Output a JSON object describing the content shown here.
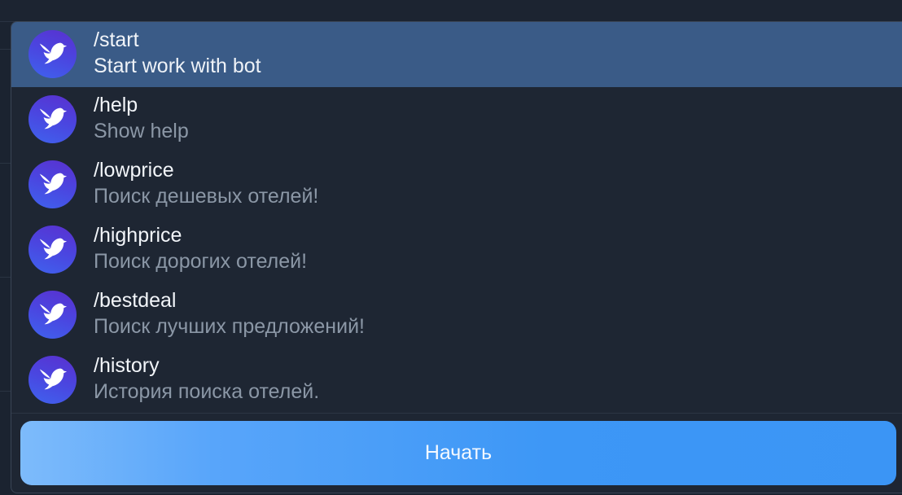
{
  "commands": [
    {
      "name": "/start",
      "description": "Start work with bot",
      "selected": true,
      "avatar_icon": "bird-icon"
    },
    {
      "name": "/help",
      "description": "Show help",
      "selected": false,
      "avatar_icon": "bird-icon"
    },
    {
      "name": "/lowprice",
      "description": "Поиск дешевых отелей!",
      "selected": false,
      "avatar_icon": "bird-icon"
    },
    {
      "name": "/highprice",
      "description": "Поиск дорогих отелей!",
      "selected": false,
      "avatar_icon": "bird-icon"
    },
    {
      "name": "/bestdeal",
      "description": "Поиск лучших предложений!",
      "selected": false,
      "avatar_icon": "bird-icon"
    },
    {
      "name": "/history",
      "description": "История поиска отелей.",
      "selected": false,
      "avatar_icon": "bird-icon"
    }
  ],
  "start_button": {
    "label": "Начать"
  },
  "colors": {
    "selected_row": "#3a5b87",
    "button_accent": "#3d97f6",
    "avatar_gradient_start": "#5a30cf",
    "avatar_gradient_end": "#3f63ee"
  }
}
